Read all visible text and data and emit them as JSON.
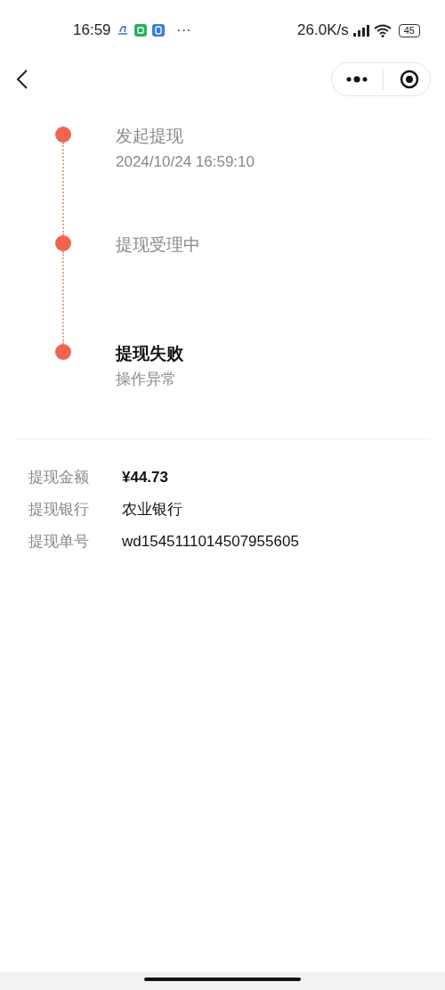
{
  "status_bar": {
    "time": "16:59",
    "more": "···",
    "speed": "26.0K/s",
    "battery": "45"
  },
  "steps": [
    {
      "title": "发起提现",
      "subtitle": "2024/10/24 16:59:10",
      "current": false
    },
    {
      "title": "提现受理中",
      "current": false
    },
    {
      "title": "提现失败",
      "subtitle": "操作异常",
      "current": true
    }
  ],
  "details": [
    {
      "label": "提现金额",
      "value": "¥44.73",
      "bold": true
    },
    {
      "label": "提现银行",
      "value": "农业银行",
      "bold": false
    },
    {
      "label": "提现单号",
      "value": "wd1545111014507955605",
      "bold": false
    }
  ]
}
